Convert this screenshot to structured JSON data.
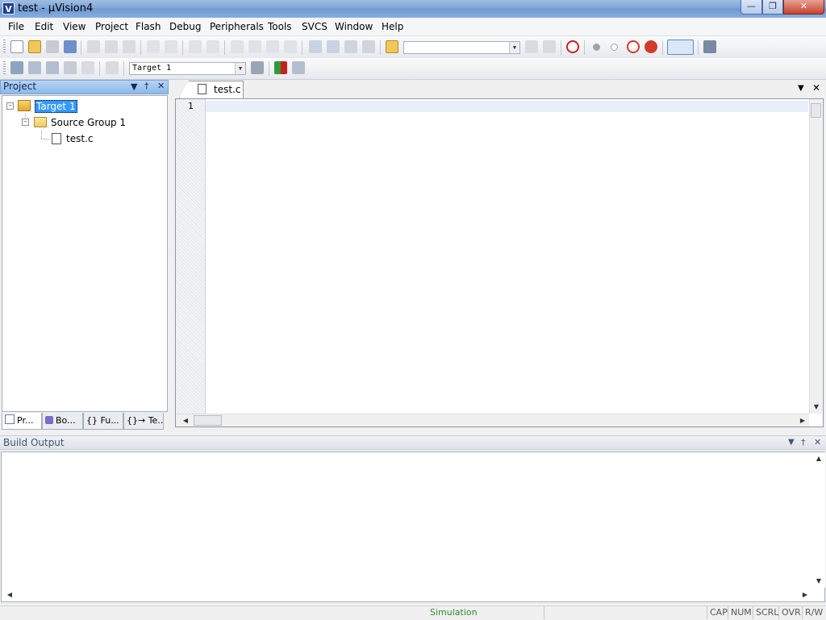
{
  "window": {
    "title": "test  - µVision4",
    "icon": "uvision-icon"
  },
  "menu": [
    "File",
    "Edit",
    "View",
    "Project",
    "Flash",
    "Debug",
    "Peripherals",
    "Tools",
    "SVCS",
    "Window",
    "Help"
  ],
  "toolbar2": {
    "target_select": "Target 1"
  },
  "project_panel": {
    "title": "Project",
    "tree": {
      "target": "Target 1",
      "group": "Source Group 1",
      "file": "test.c"
    },
    "tabs": [
      "Pr...",
      "Bo...",
      "{} Fu...",
      "{}→ Te..."
    ]
  },
  "editor": {
    "tab_label": "test.c",
    "line_numbers": [
      "1"
    ]
  },
  "build_output": {
    "title": "Build Output"
  },
  "status": {
    "mode": "Simulation",
    "indicators": [
      "CAP",
      "NUM",
      "SCRL",
      "OVR",
      "R/W"
    ]
  },
  "colors": {
    "selection": "#3399ff",
    "status_mode": "#2e8b2e",
    "panel_header": "#8cb8e9"
  }
}
